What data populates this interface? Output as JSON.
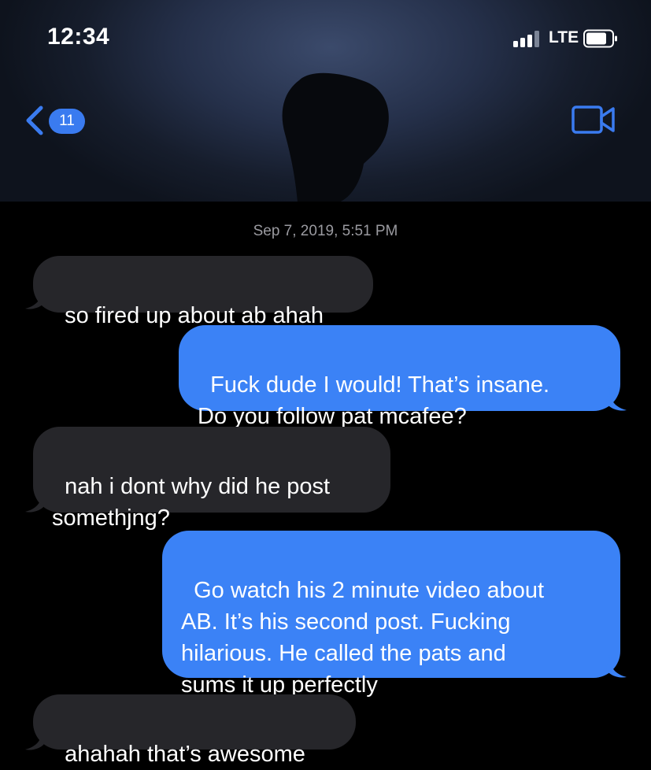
{
  "status_bar": {
    "time": "12:34",
    "network": "LTE"
  },
  "nav": {
    "back_count": "11"
  },
  "colors": {
    "incoming_bubble": "#26262a",
    "outgoing_bubble": "#3b82f6",
    "accent": "#3a7bf0"
  },
  "thread": {
    "timestamp": "Sep 7, 2019, 5:51 PM",
    "messages": [
      {
        "direction": "incoming",
        "text": "so fired up about ab ahah"
      },
      {
        "direction": "outgoing",
        "text": "Fuck dude I would! That’s insane.\nDo you follow pat mcafee?"
      },
      {
        "direction": "incoming",
        "text": "nah i dont why did he post\nsomethjng?"
      },
      {
        "direction": "outgoing",
        "text": "Go watch his 2 minute video about\nAB. It’s his second post. Fucking\nhilarious. He called the pats and\nsums it up perfectly"
      },
      {
        "direction": "incoming",
        "text": "ahahah that’s awesome"
      }
    ]
  },
  "icons": [
    "back-chevron-icon",
    "video-call-icon",
    "signal-icon",
    "battery-icon",
    "contact-avatar"
  ]
}
